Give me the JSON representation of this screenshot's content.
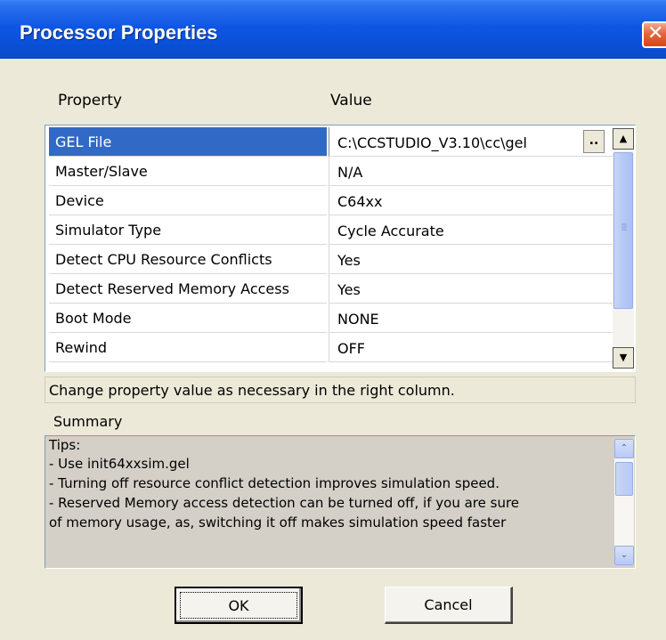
{
  "window": {
    "title": "Processor Properties",
    "close_glyph": "✕"
  },
  "grid": {
    "header_property": "Property",
    "header_value": "Value",
    "ellipsis_label": "..",
    "rows": [
      {
        "property": "GEL File",
        "value": "C:\\CCSTUDIO_V3.10\\cc\\gel",
        "selected": true
      },
      {
        "property": "Master/Slave",
        "value": "N/A"
      },
      {
        "property": "Device",
        "value": "C64xx"
      },
      {
        "property": "Simulator Type",
        "value": "Cycle Accurate"
      },
      {
        "property": "Detect CPU Resource Conflicts",
        "value": "Yes"
      },
      {
        "property": "Detect Reserved Memory Access",
        "value": "Yes"
      },
      {
        "property": "Boot Mode",
        "value": "NONE"
      },
      {
        "property": "Rewind",
        "value": "OFF"
      }
    ]
  },
  "status_text": "Change property value as necessary in the right column.",
  "summary": {
    "label": "Summary",
    "lines": [
      "Tips:",
      "- Use init64xxsim.gel",
      "- Turning off resource conflict detection improves simulation speed.",
      "- Reserved Memory access detection can be turned off, if you are sure",
      "of memory usage, as, switching it off makes simulation speed faster"
    ]
  },
  "buttons": {
    "ok": "OK",
    "cancel": "Cancel"
  },
  "icons": {
    "scroll_up": "▲",
    "scroll_down": "▼",
    "scroll_up_small": "⌃",
    "scroll_down_small": "⌄"
  },
  "colors": {
    "title_bar": "#0a4fd8",
    "selection": "#316ac5",
    "close_button": "#d8431c",
    "window_bg": "#ece9d8"
  }
}
